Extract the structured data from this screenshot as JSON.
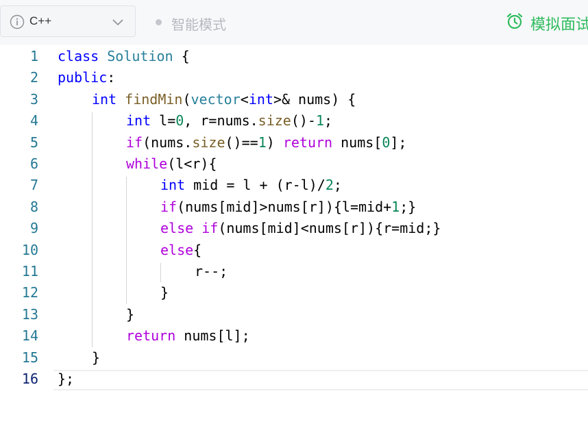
{
  "toolbar": {
    "language": "C++",
    "mode_label": "智能模式",
    "mock_interview_label": "模拟面试"
  },
  "colors": {
    "keyword": "#0000ff",
    "control": "#af00db",
    "function": "#795e26",
    "type": "#267f99",
    "number": "#098658",
    "text": "#000000",
    "line_number": "#237893",
    "accent_green": "#2ebb5d"
  },
  "editor": {
    "active_line": 16,
    "lines": [
      {
        "n": "1",
        "indent": 0,
        "tokens": [
          [
            "kw",
            "class"
          ],
          [
            "t",
            " "
          ],
          [
            "type",
            "Solution"
          ],
          [
            "t",
            " {"
          ]
        ]
      },
      {
        "n": "2",
        "indent": 0,
        "tokens": [
          [
            "kw",
            "public"
          ],
          [
            "t",
            ":"
          ]
        ]
      },
      {
        "n": "3",
        "indent": 1,
        "tokens": [
          [
            "kw",
            "int"
          ],
          [
            "t",
            " "
          ],
          [
            "fn",
            "findMin"
          ],
          [
            "t",
            "("
          ],
          [
            "type",
            "vector"
          ],
          [
            "t",
            "<"
          ],
          [
            "kw",
            "int"
          ],
          [
            "t",
            ">& nums) {"
          ]
        ]
      },
      {
        "n": "4",
        "indent": 2,
        "tokens": [
          [
            "kw",
            "int"
          ],
          [
            "t",
            " l="
          ],
          [
            "num",
            "0"
          ],
          [
            "t",
            ", r=nums."
          ],
          [
            "fn",
            "size"
          ],
          [
            "t",
            "()-"
          ],
          [
            "num",
            "1"
          ],
          [
            "t",
            ";"
          ]
        ]
      },
      {
        "n": "5",
        "indent": 2,
        "tokens": [
          [
            "ctrl",
            "if"
          ],
          [
            "t",
            "(nums."
          ],
          [
            "fn",
            "size"
          ],
          [
            "t",
            "()=="
          ],
          [
            "num",
            "1"
          ],
          [
            "t",
            ") "
          ],
          [
            "ctrl",
            "return"
          ],
          [
            "t",
            " nums["
          ],
          [
            "num",
            "0"
          ],
          [
            "t",
            "];"
          ]
        ]
      },
      {
        "n": "6",
        "indent": 2,
        "tokens": [
          [
            "ctrl",
            "while"
          ],
          [
            "t",
            "(l<r){"
          ]
        ]
      },
      {
        "n": "7",
        "indent": 3,
        "tokens": [
          [
            "kw",
            "int"
          ],
          [
            "t",
            " mid = l + (r-l)/"
          ],
          [
            "num",
            "2"
          ],
          [
            "t",
            ";"
          ]
        ]
      },
      {
        "n": "8",
        "indent": 3,
        "tokens": [
          [
            "ctrl",
            "if"
          ],
          [
            "t",
            "(nums[mid]>nums[r]){l=mid+"
          ],
          [
            "num",
            "1"
          ],
          [
            "t",
            ";}"
          ]
        ]
      },
      {
        "n": "9",
        "indent": 3,
        "tokens": [
          [
            "ctrl",
            "else"
          ],
          [
            "t",
            " "
          ],
          [
            "ctrl",
            "if"
          ],
          [
            "t",
            "(nums[mid]<nums[r]){r=mid;}"
          ]
        ]
      },
      {
        "n": "10",
        "indent": 3,
        "tokens": [
          [
            "ctrl",
            "else"
          ],
          [
            "t",
            "{"
          ]
        ]
      },
      {
        "n": "11",
        "indent": 4,
        "tokens": [
          [
            "t",
            "r--;"
          ]
        ]
      },
      {
        "n": "12",
        "indent": 3,
        "tokens": [
          [
            "t",
            "}"
          ]
        ]
      },
      {
        "n": "13",
        "indent": 2,
        "tokens": [
          [
            "t",
            "}"
          ]
        ]
      },
      {
        "n": "14",
        "indent": 2,
        "tokens": [
          [
            "ctrl",
            "return"
          ],
          [
            "t",
            " nums[l];"
          ]
        ]
      },
      {
        "n": "15",
        "indent": 1,
        "tokens": [
          [
            "t",
            "}"
          ]
        ]
      },
      {
        "n": "16",
        "indent": 0,
        "tokens": [
          [
            "t",
            "};"
          ]
        ]
      }
    ]
  }
}
